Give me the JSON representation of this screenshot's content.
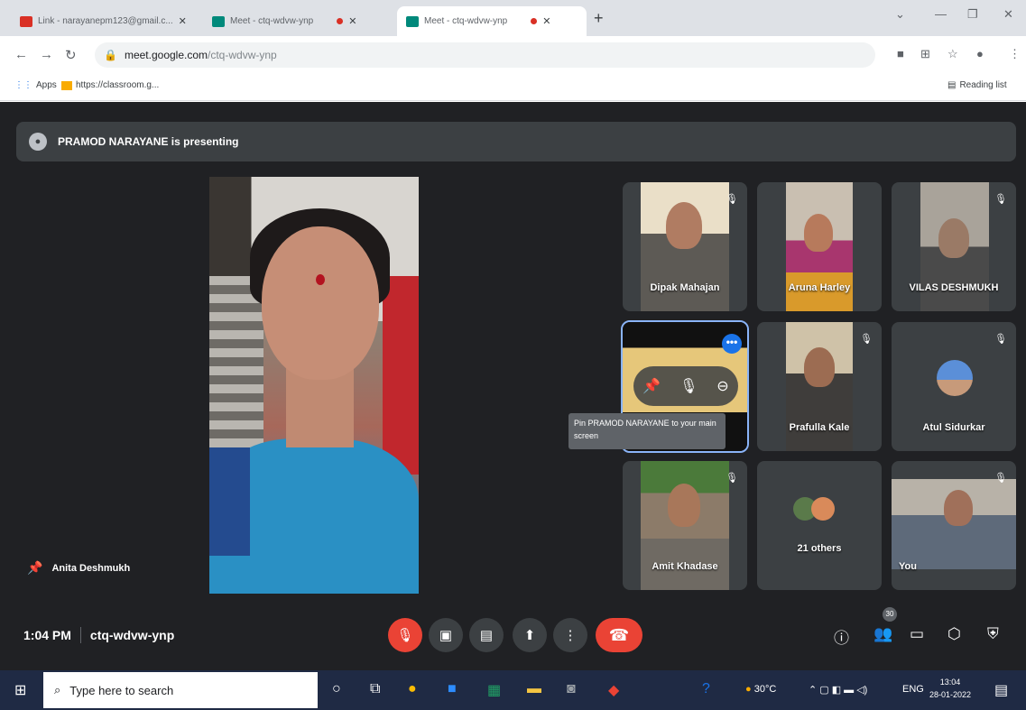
{
  "browser": {
    "tabs": [
      {
        "label": "Link - narayanepm123@gmail.c...",
        "icon": "gmail-icon",
        "color": "#d93025"
      },
      {
        "label": "Meet - ctq-wdvw-ynp",
        "icon": "meet-icon",
        "color": "#00897b"
      },
      {
        "label": "Meet - ctq-wdvw-ynp",
        "icon": "meet-icon",
        "color": "#00897b"
      }
    ],
    "url_host": "meet.google.com",
    "url_path": "/ctq-wdvw-ynp",
    "bookmarks": [
      {
        "label": "Apps"
      },
      {
        "label": "https://classroom.g..."
      }
    ],
    "reading_list": "Reading list"
  },
  "meet": {
    "presenting_text": "PRAMOD NARAYANE is presenting",
    "main_speaker": "Anita Deshmukh",
    "tiles": [
      {
        "name": "Dipak Mahajan",
        "muted": true
      },
      {
        "name": "Aruna Harley",
        "muted": false
      },
      {
        "name": "VILAS DESHMUKH",
        "muted": true
      },
      {
        "name": "",
        "muted": false
      },
      {
        "name": "Prafulla Kale",
        "muted": true
      },
      {
        "name": "Atul Sidurkar",
        "muted": true
      },
      {
        "name": "Amit Khadase",
        "muted": true
      },
      {
        "name": "21 others",
        "muted": false
      },
      {
        "name": "You",
        "muted": true
      }
    ],
    "tooltip": "Pin PRAMOD NARAYANE to your main screen",
    "time": "1:04 PM",
    "code": "ctq-wdvw-ynp",
    "participants_count": "30"
  },
  "taskbar": {
    "search_placeholder": "Type here to search",
    "temp": "30°C",
    "lang": "ENG",
    "time": "13:04",
    "date": "28-01-2022"
  }
}
